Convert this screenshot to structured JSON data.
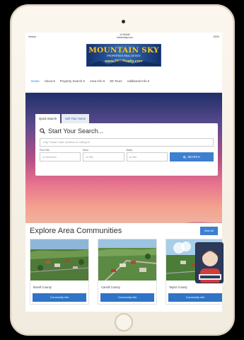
{
  "statusbar": {
    "carrier": "Verizon",
    "time": "12:08 AM",
    "url": "sdnvrealty.com",
    "battery": "100%"
  },
  "logo": {
    "title": "MOUNTAIN SKY",
    "subtitle": "PROPERTIES REAL ESTATE",
    "url": "www.DNVRealty.com"
  },
  "nav": [
    "Home",
    "About",
    "Property Search",
    "Area Info",
    "3D Tours",
    "Additional Info"
  ],
  "search": {
    "tabs": [
      "Quick Search",
      "Sell Your Home"
    ],
    "title": "Start Your Search...",
    "placeholder": "City, Postal Code, Address or Listing ID",
    "fields": [
      {
        "label": "Price Min",
        "placeholder": "no Minimum"
      },
      {
        "label": "Beds",
        "placeholder": "no Min"
      },
      {
        "label": "Baths",
        "placeholder": "no Min"
      }
    ],
    "button": "SEARCH"
  },
  "explore": {
    "title": "Explore Area Communities",
    "view_all": "View All",
    "cards": [
      {
        "name": "Boxell County",
        "button": "Community Info"
      },
      {
        "name": "Carroll County",
        "button": "Community Info"
      },
      {
        "name": "Taylor County",
        "button": "Community Info"
      }
    ]
  },
  "colors": {
    "accent": "#3d7fd0",
    "logo_gold": "#f5c431",
    "nav_active": "#2d7bc4"
  }
}
